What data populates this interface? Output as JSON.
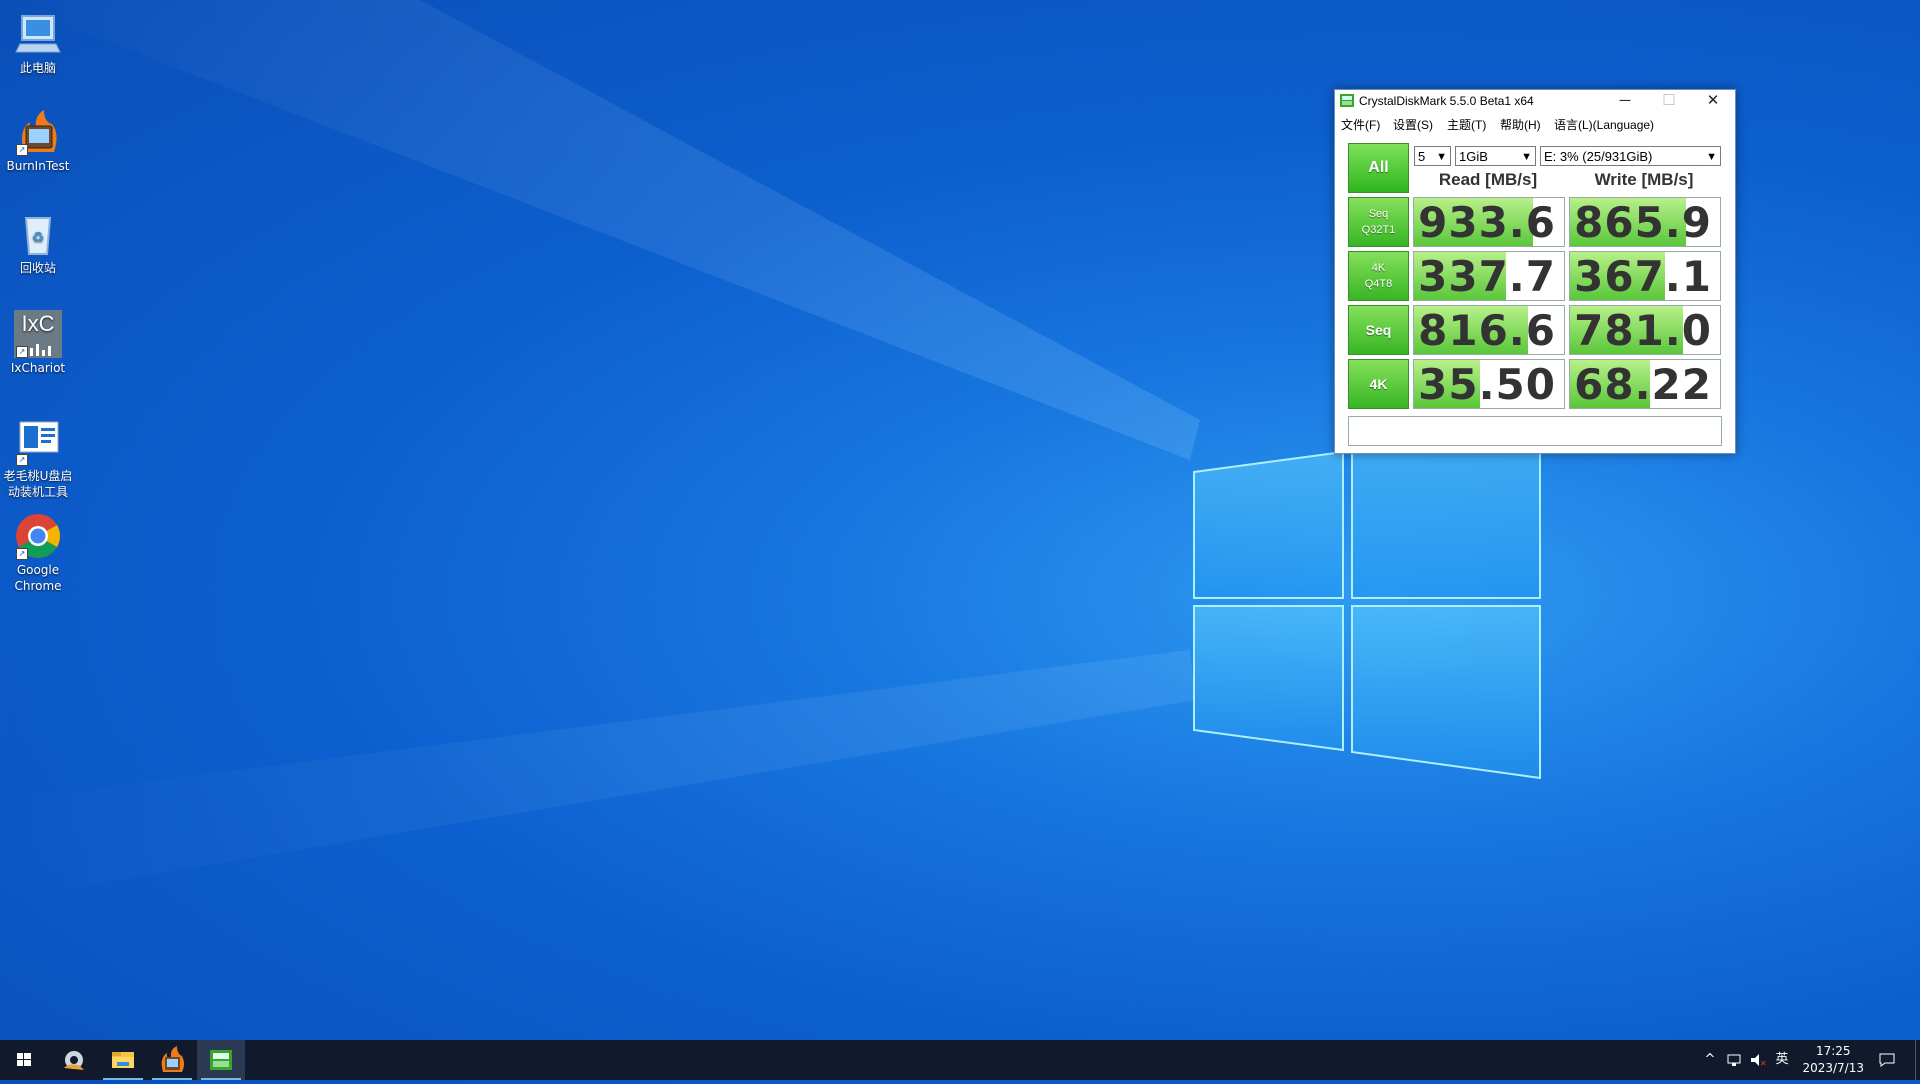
{
  "desktop": {
    "icons": [
      {
        "label": "此电脑",
        "icon": "computer-icon"
      },
      {
        "label": "BurnInTest",
        "icon": "burnintest-icon"
      },
      {
        "label": "回收站",
        "icon": "recycle-bin-icon"
      },
      {
        "label": "IxChariot",
        "icon": "ixchariot-icon"
      },
      {
        "label": "老毛桃U盘启\n动装机工具",
        "icon": "laomaotao-icon"
      },
      {
        "label": "Google\nChrome",
        "icon": "chrome-icon"
      }
    ],
    "ixchariot_logo_text": "IxC"
  },
  "window": {
    "title": "CrystalDiskMark 5.5.0 Beta1 x64",
    "buttons": {
      "minimize": "─",
      "maximize": "☐",
      "close": "✕"
    },
    "menu": [
      "文件(F)",
      "设置(S)",
      "主题(T)",
      "帮助(H)",
      "语言(L)(Language)"
    ],
    "all_button": "All",
    "count_select": "5",
    "size_select": "1GiB",
    "drive_select": "E: 3% (25/931GiB)",
    "headers": {
      "read": "Read [MB/s]",
      "write": "Write [MB/s]"
    },
    "rows": [
      {
        "label1": "Seq",
        "label2": "Q32T1",
        "read": "933.6",
        "write": "865.9",
        "read_pct": 0.79,
        "write_pct": 0.77
      },
      {
        "label1": "4K",
        "label2": "Q4T8",
        "read": "337.7",
        "write": "367.1",
        "read_pct": 0.61,
        "write_pct": 0.63
      },
      {
        "label1": "Seq",
        "label2": "",
        "read": "816.6",
        "write": "781.0",
        "read_pct": 0.76,
        "write_pct": 0.75
      },
      {
        "label1": "4K",
        "label2": "",
        "read": "35.50",
        "write": "68.22",
        "read_pct": 0.44,
        "write_pct": 0.53
      }
    ],
    "comment": ""
  },
  "taskbar": {
    "tray": {
      "chevron": "^",
      "ime": "英"
    },
    "time": "17:25",
    "date": "2023/7/13"
  },
  "colors": {
    "accent_green": "#37b524",
    "bar_green": "#59c73a",
    "taskbar": "#101a2c",
    "desktop": "#0d5fcf"
  }
}
